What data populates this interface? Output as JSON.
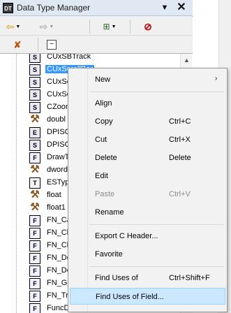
{
  "window": {
    "title": "Data Type Manager",
    "app_icon_text": "DT"
  },
  "toolbar": {
    "back_icon": "back-arrow-icon",
    "forward_icon": "forward-arrow-icon",
    "structure_icon": "structure-icon",
    "filter_icon": "filter-off-icon",
    "delete_icon": "delete-type-icon",
    "collapse_icon": "collapse-icon"
  },
  "tree": {
    "items": [
      {
        "label": "CUxSBTrack",
        "type": "S"
      },
      {
        "label": "CUxScrollBar",
        "type": "S",
        "selected": true
      },
      {
        "label": "CUxSc",
        "type": "S"
      },
      {
        "label": "CUxSc",
        "type": "S"
      },
      {
        "label": "CZoom",
        "type": "S"
      },
      {
        "label": "doubl",
        "type": "hammer"
      },
      {
        "label": "DPISC",
        "type": "E"
      },
      {
        "label": "DPISC",
        "type": "S"
      },
      {
        "label": "DrawT",
        "type": "F"
      },
      {
        "label": "dword",
        "type": "hammer"
      },
      {
        "label": "ESTyp",
        "type": "T"
      },
      {
        "label": "float",
        "type": "hammer"
      },
      {
        "label": "float1",
        "type": "hammer"
      },
      {
        "label": "FN_Ca",
        "type": "F"
      },
      {
        "label": "FN_Cl",
        "type": "F"
      },
      {
        "label": "FN_Cl",
        "type": "F"
      },
      {
        "label": "FN_De",
        "type": "F"
      },
      {
        "label": "FN_De",
        "type": "F"
      },
      {
        "label": "FN_Ge",
        "type": "F"
      },
      {
        "label": "FN_Tr",
        "type": "F"
      },
      {
        "label": "FuncD",
        "type": "F"
      }
    ]
  },
  "context_menu": {
    "items": [
      {
        "label": "New",
        "shortcut": "",
        "submenu": true
      },
      {
        "separator": true
      },
      {
        "label": "Align",
        "shortcut": ""
      },
      {
        "label": "Copy",
        "shortcut": "Ctrl+C"
      },
      {
        "label": "Cut",
        "shortcut": "Ctrl+X"
      },
      {
        "label": "Delete",
        "shortcut": "Delete"
      },
      {
        "label": "Edit",
        "shortcut": ""
      },
      {
        "label": "Paste",
        "shortcut": "Ctrl+V",
        "disabled": true
      },
      {
        "label": "Rename",
        "shortcut": ""
      },
      {
        "separator": true
      },
      {
        "label": "Export C Header...",
        "shortcut": ""
      },
      {
        "label": "Favorite",
        "shortcut": ""
      },
      {
        "separator": true
      },
      {
        "label": "Find Uses of",
        "shortcut": "Ctrl+Shift+F"
      },
      {
        "label": "Find Uses of Field...",
        "shortcut": "",
        "hover": true
      }
    ]
  },
  "colors": {
    "selection": "#3399ff",
    "menu_hover": "#cce8ff",
    "titlebar": "#dfe8f3"
  }
}
